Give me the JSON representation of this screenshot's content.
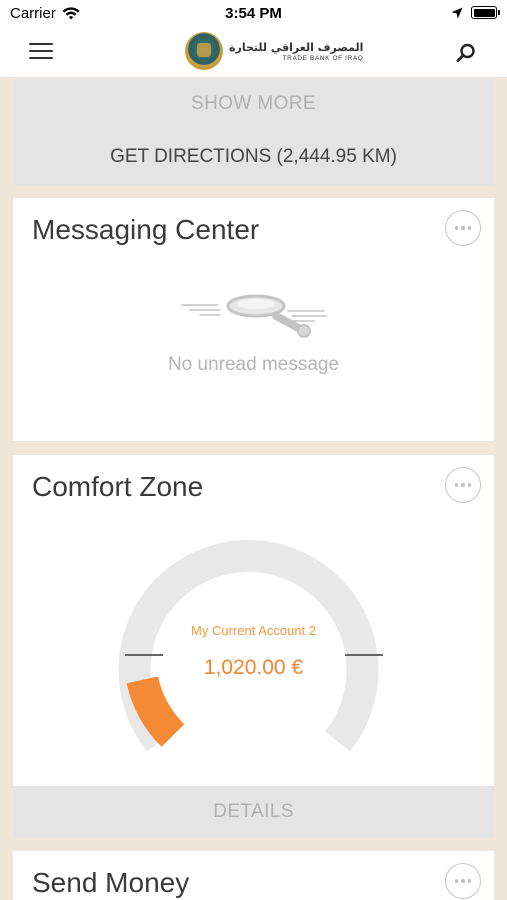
{
  "status_bar": {
    "carrier": "Carrier",
    "time": "3:54 PM"
  },
  "nav": {
    "logo_ar": "المصرف العراقي للتجارة",
    "logo_en": "TRADE BANK OF IRAQ",
    "menu_icon": "hamburger-menu-icon",
    "search_icon": "search-icon"
  },
  "branch_card": {
    "show_more": "SHOW MORE",
    "get_directions": "GET DIRECTIONS (2,444.95 KM)"
  },
  "messaging": {
    "title": "Messaging Center",
    "empty_text": "No unread message"
  },
  "comfort": {
    "title": "Comfort Zone",
    "account": "My Current Account 2",
    "amount": "1,020.00 €",
    "level": 0.12,
    "details": "DETAILS"
  },
  "send_money": {
    "title": "Send Money"
  },
  "colors": {
    "accent": "#f3852f",
    "background": "#efe5d8",
    "card_gray": "#e4e4e4"
  }
}
